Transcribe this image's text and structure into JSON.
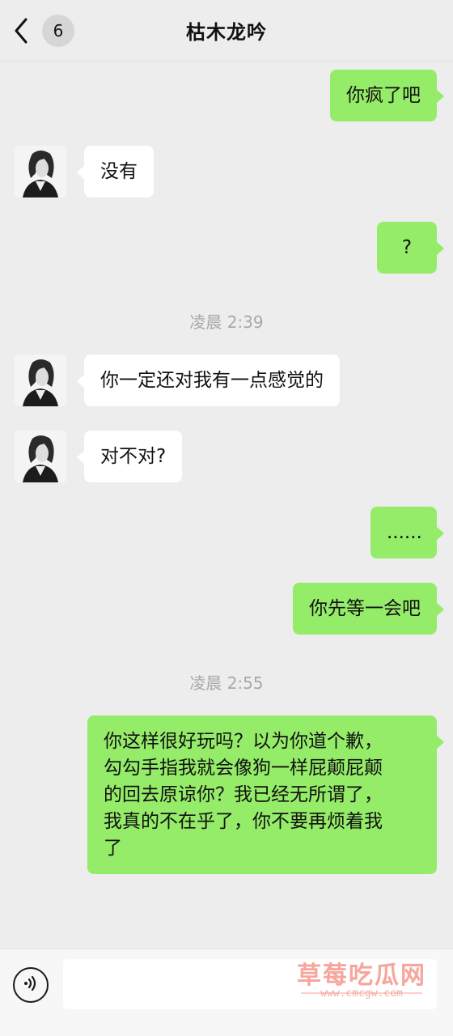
{
  "header": {
    "back_count": "6",
    "title": "枯木龙吟"
  },
  "messages": [
    {
      "side": "out",
      "text": "你疯了吧"
    },
    {
      "side": "in",
      "text": "没有"
    },
    {
      "side": "out",
      "text": "?"
    },
    {
      "timestamp": "凌晨 2:39"
    },
    {
      "side": "in",
      "text": "你一定还对我有一点感觉的"
    },
    {
      "side": "in",
      "text": "对不对?"
    },
    {
      "side": "out",
      "text": "......"
    },
    {
      "side": "out",
      "text": "你先等一会吧"
    },
    {
      "timestamp": "凌晨 2:55"
    },
    {
      "side": "out",
      "text": "你这样很好玩吗？以为你道个歉，\n勾勾手指我就会像狗一样屁颠屁颠\n的回去原谅你？我已经无所谓了，\n我真的不在乎了，你不要再烦着我\n了"
    }
  ],
  "input": {
    "value": ""
  },
  "watermark": {
    "title": "草莓吃瓜网",
    "url": "www.cmcgw.com"
  },
  "colors": {
    "outgoing_bubble": "#95ec69",
    "incoming_bubble": "#ffffff",
    "background": "#ededed"
  }
}
